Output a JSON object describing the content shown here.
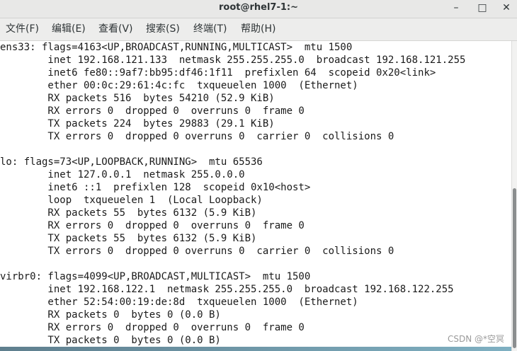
{
  "window": {
    "title": "root@rhel7-1:~",
    "controls": {
      "minimize": "–",
      "maximize": "□",
      "close": "✕"
    }
  },
  "menubar": {
    "items": [
      {
        "label": "文件(F)"
      },
      {
        "label": "编辑(E)"
      },
      {
        "label": "查看(V)"
      },
      {
        "label": "搜索(S)"
      },
      {
        "label": "终端(T)"
      },
      {
        "label": "帮助(H)"
      }
    ]
  },
  "terminal": {
    "lines": [
      "ens33: flags=4163<UP,BROADCAST,RUNNING,MULTICAST>  mtu 1500",
      "        inet 192.168.121.133  netmask 255.255.255.0  broadcast 192.168.121.255",
      "        inet6 fe80::9af7:bb95:df46:1f11  prefixlen 64  scopeid 0x20<link>",
      "        ether 00:0c:29:61:4c:fc  txqueuelen 1000  (Ethernet)",
      "        RX packets 516  bytes 54210 (52.9 KiB)",
      "        RX errors 0  dropped 0  overruns 0  frame 0",
      "        TX packets 224  bytes 29883 (29.1 KiB)",
      "        TX errors 0  dropped 0 overruns 0  carrier 0  collisions 0",
      "",
      "lo: flags=73<UP,LOOPBACK,RUNNING>  mtu 65536",
      "        inet 127.0.0.1  netmask 255.0.0.0",
      "        inet6 ::1  prefixlen 128  scopeid 0x10<host>",
      "        loop  txqueuelen 1  (Local Loopback)",
      "        RX packets 55  bytes 6132 (5.9 KiB)",
      "        RX errors 0  dropped 0  overruns 0  frame 0",
      "        TX packets 55  bytes 6132 (5.9 KiB)",
      "        TX errors 0  dropped 0 overruns 0  carrier 0  collisions 0",
      "",
      "virbr0: flags=4099<UP,BROADCAST,MULTICAST>  mtu 1500",
      "        inet 192.168.122.1  netmask 255.255.255.0  broadcast 192.168.122.255",
      "        ether 52:54:00:19:de:8d  txqueuelen 1000  (Ethernet)",
      "        RX packets 0  bytes 0 (0.0 B)",
      "        RX errors 0  dropped 0  overruns 0  frame 0",
      "        TX packets 0  bytes 0 (0.0 B)"
    ]
  },
  "watermark": "CSDN @*空冥",
  "colors": {
    "titlebar_bg": "#e8e8e7",
    "menubar_bg": "#ededec",
    "terminal_bg": "#ffffff",
    "terminal_fg": "#1a1a1a",
    "scroll_thumb": "#8b8e8f"
  }
}
